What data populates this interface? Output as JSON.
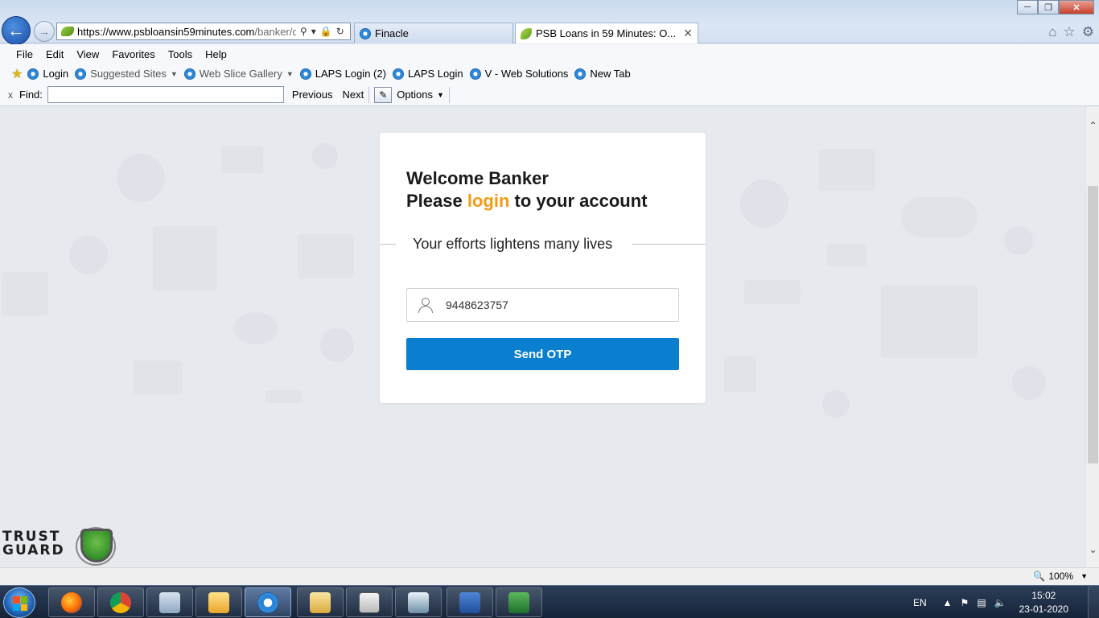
{
  "browser": {
    "url_domain": "https://www.psbloansin59minutes.com",
    "url_path": "/banker/cw",
    "tabs": [
      {
        "label": "Finacle"
      },
      {
        "label": "PSB Loans in 59 Minutes: O..."
      }
    ],
    "window": {
      "minimize": "─",
      "maximize": "❐",
      "close": "✕"
    }
  },
  "menu": {
    "items": [
      "File",
      "Edit",
      "View",
      "Favorites",
      "Tools",
      "Help"
    ]
  },
  "favorites": {
    "items": [
      {
        "label": "Login",
        "icon": "ie-icon"
      },
      {
        "label": "Suggested Sites",
        "icon": "ie-icon",
        "dropdown": true
      },
      {
        "label": "Web Slice Gallery",
        "icon": "ie-icon",
        "dropdown": true
      },
      {
        "label": "LAPS Login (2)",
        "icon": "ie-icon"
      },
      {
        "label": "LAPS Login",
        "icon": "ie-icon"
      },
      {
        "label": "V - Web Solutions",
        "icon": "ie-icon"
      },
      {
        "label": "New Tab",
        "icon": "ie-icon"
      }
    ]
  },
  "findbar": {
    "close": "x",
    "label": "Find:",
    "value": "",
    "previous": "Previous",
    "next": "Next",
    "options": "Options"
  },
  "login": {
    "title": "Welcome Banker",
    "subtitle_pre": "Please ",
    "subtitle_accent": "login",
    "subtitle_post": " to your account",
    "tagline": "Your efforts lightens many lives",
    "mobile_value": "9448623757",
    "send_otp": "Send OTP",
    "accent_color": "#f39c12",
    "button_color": "#0a7fcf"
  },
  "trustguard": {
    "line1": "TRUST",
    "line2": "GUARD"
  },
  "statusbar": {
    "zoom": "100%"
  },
  "taskbar": {
    "lang": "EN",
    "time": "15:02",
    "date": "23-01-2020",
    "apps": [
      "firefox",
      "chrome",
      "calculator",
      "outlook",
      "internet-explorer",
      "file-explorer",
      "finacle",
      "presentation",
      "word",
      "excel"
    ]
  }
}
